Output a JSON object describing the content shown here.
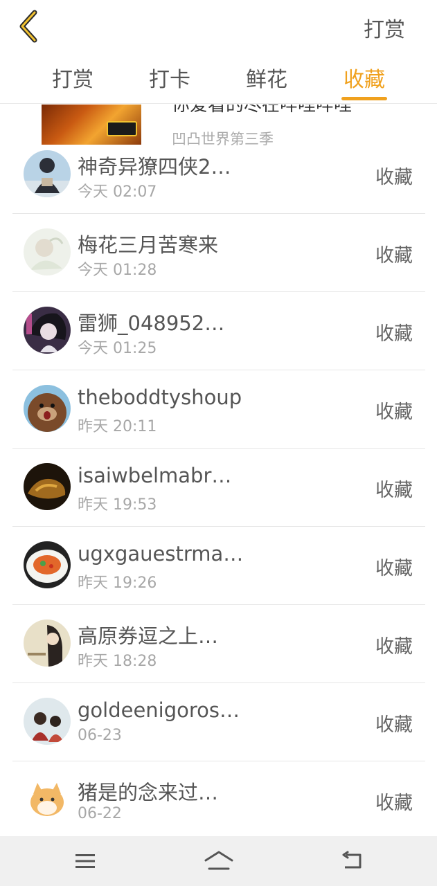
{
  "header": {
    "back_icon": "chevron-left-icon",
    "action_label": "打赏",
    "accent_color": "#f0a11e"
  },
  "tabs": [
    {
      "label": "打赏",
      "active": false
    },
    {
      "label": "打卡",
      "active": false
    },
    {
      "label": "鲜花",
      "active": false
    },
    {
      "label": "收藏",
      "active": true
    }
  ],
  "partial_card": {
    "title": "你爱看的尽在哔哩哔哩",
    "subtitle": "凹凸世界第三季"
  },
  "records": [
    {
      "name": "神奇异獠四侠2…",
      "time": "今天 02:07",
      "action": "收藏"
    },
    {
      "name": "梅花三月苦寒来",
      "time": "今天 01:28",
      "action": "收藏"
    },
    {
      "name": "雷狮_048952…",
      "time": "今天 01:25",
      "action": "收藏"
    },
    {
      "name": "theboddtyshoup",
      "time": "昨天 20:11",
      "action": "收藏"
    },
    {
      "name": "isaiwbelmabr…",
      "time": "昨天 19:53",
      "action": "收藏"
    },
    {
      "name": "ugxgauestrma…",
      "time": "昨天 19:26",
      "action": "收藏"
    },
    {
      "name": "高原券逗之上…",
      "time": "昨天 18:28",
      "action": "收藏"
    },
    {
      "name": "goldeenigoros…",
      "time": "06-23",
      "action": "收藏"
    },
    {
      "name": "猪是的念来过…",
      "time": "06-22",
      "action": "收藏"
    }
  ],
  "navbar": {
    "icons": [
      "menu-icon",
      "home-icon",
      "back-icon"
    ]
  }
}
